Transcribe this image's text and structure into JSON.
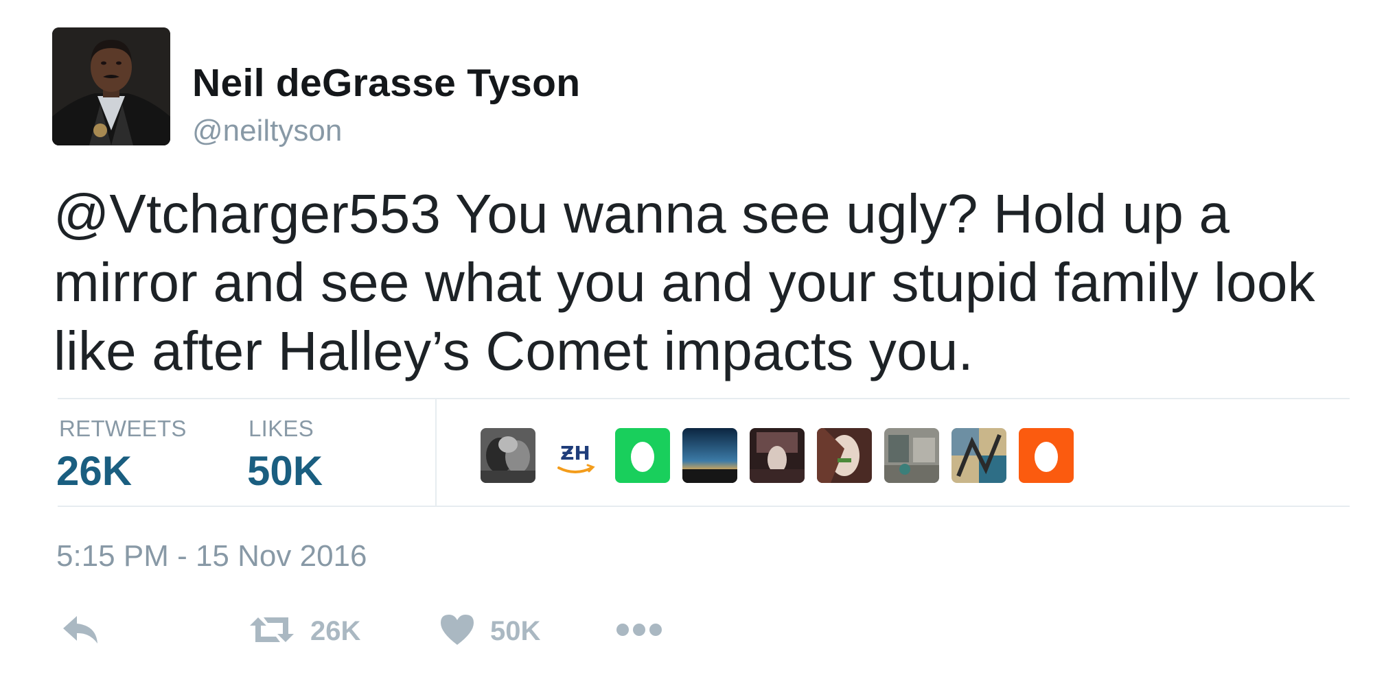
{
  "author": {
    "display_name": "Neil deGrasse Tyson",
    "handle": "@neiltyson",
    "avatar": "profile-photo"
  },
  "tweet": {
    "text": "@Vtcharger553 You wanna see ugly? Hold up a mirror and see what you and your stupid family look like after Halley’s Comet impacts you."
  },
  "stats": {
    "retweets_label": "RETWEETS",
    "retweets_value": "26K",
    "likes_label": "LIKES",
    "likes_value": "50K",
    "liker_avatars": [
      "bw-photo-avatar",
      "zh-logo-avatar",
      "default-egg-avatar-green",
      "sunset-landscape-avatar",
      "concert-photo-avatar",
      "portrait-photo-avatar",
      "street-photo-avatar",
      "collage-avatar",
      "default-egg-avatar-orange"
    ]
  },
  "timestamp": "5:15 PM - 15 Nov 2016",
  "actions": {
    "reply_icon": "reply-arrow-icon",
    "retweet_icon": "retweet-arrows-icon",
    "retweet_count": "26K",
    "like_icon": "heart-icon",
    "like_count": "50K",
    "more_icon": "more-dots-icon"
  },
  "colors": {
    "stat_value": "#1a5e80",
    "muted": "#8899a6",
    "icon": "#aab8c2",
    "divider": "#e6ecf0",
    "egg_green": "#19cf5c",
    "egg_orange": "#fb5b0f"
  }
}
